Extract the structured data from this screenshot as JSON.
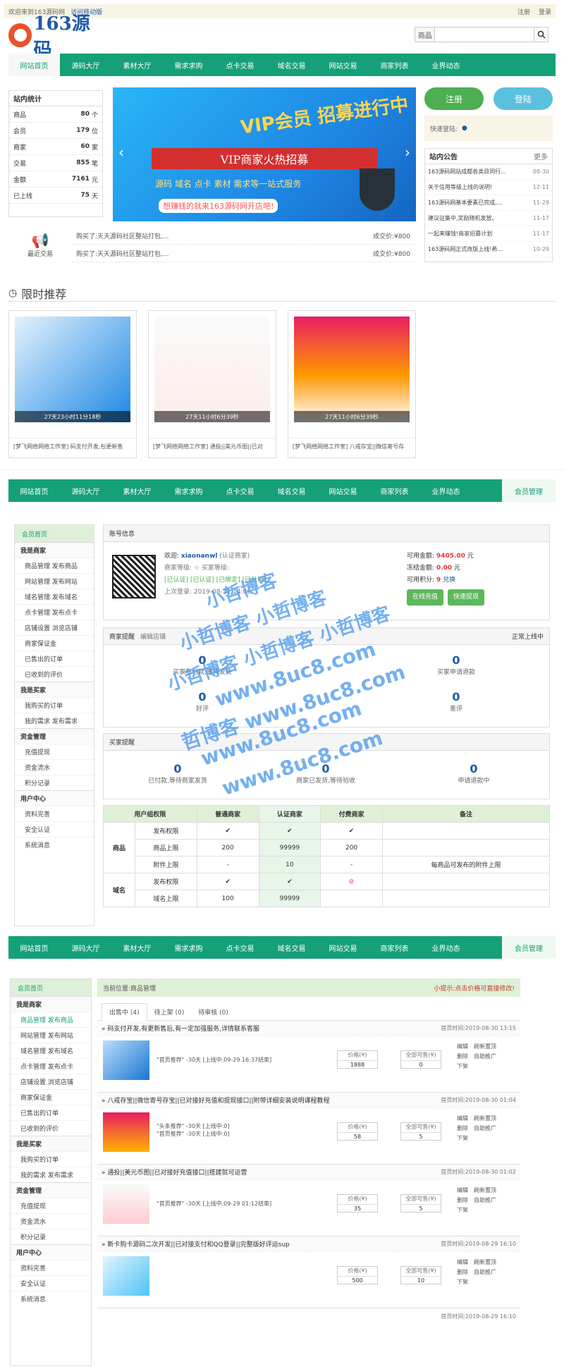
{
  "topbar": {
    "welcome": "欢迎来到163源码网",
    "mobile": "访问移动版",
    "register": "注册",
    "login": "登录"
  },
  "logo": {
    "text": "163源码"
  },
  "search": {
    "label": "商品",
    "placeholder": ""
  },
  "nav": {
    "items": [
      "网站首页",
      "源码大厅",
      "素材大厅",
      "需求求购",
      "点卡交易",
      "域名交易",
      "网站交易",
      "商家列表",
      "业界动态"
    ],
    "member": "会员管理"
  },
  "stats": {
    "title": "站内统计",
    "rows": [
      {
        "label": "商品",
        "value": "80",
        "unit": "个"
      },
      {
        "label": "会员",
        "value": "179",
        "unit": "位"
      },
      {
        "label": "商家",
        "value": "60",
        "unit": "家"
      },
      {
        "label": "交易",
        "value": "855",
        "unit": "笔"
      },
      {
        "label": "金额",
        "value": "7161",
        "unit": "元"
      },
      {
        "label": "已上线",
        "value": "75",
        "unit": "天"
      }
    ]
  },
  "banner": {
    "vip": "VIP会员 招募进行中",
    "ribbon": "VIP商家火热招募",
    "sub": "源码 域名 点卡 素材 需求等一站式服务",
    "sub2": "想赚钱的就来163源码网开店吧!"
  },
  "buttons": {
    "register": "注册",
    "login": "登陆"
  },
  "quick_login": "快速登陆:",
  "notice": {
    "title": "站内公告",
    "more": "更多",
    "rows": [
      {
        "text": "163源码网站成都各类目同行...",
        "date": "08-30"
      },
      {
        "text": "关于信用等级上线的说明!",
        "date": "12-11"
      },
      {
        "text": "163源码网基本要素已完成,...",
        "date": "11-29"
      },
      {
        "text": "建议征集中,奖励随机发放。",
        "date": "11-17"
      },
      {
        "text": "一起来赚钱!商家招募计划",
        "date": "11-17"
      },
      {
        "text": "163源码网正式改版上线!希...",
        "date": "10-29"
      }
    ]
  },
  "recent": {
    "label": "最近交易",
    "rows": [
      {
        "text": "购买了:天天源码社区整站打包,...",
        "price": "成交价:¥800"
      },
      {
        "text": "购买了:天天源码社区整站打包,...",
        "price": "成交价:¥800"
      }
    ]
  },
  "limited": {
    "title": "限时推荐",
    "cards": [
      {
        "timer": "27天23小时11分18秒",
        "caption": "[梦飞网络网络工作室] 码支付开发,包更新售"
      },
      {
        "timer": "27天11小时6分39秒",
        "caption": "[梦飞网络网络工作室] 通投||美元币图||已对"
      },
      {
        "timer": "27天11小时6分39秒",
        "caption": "[梦飞网络网络工作室] 八戒存宝||微信寄号存"
      }
    ]
  },
  "member_side": {
    "home": "会员首页",
    "groups": [
      {
        "title": "我是商家",
        "items": [
          "商品管理 发布商品",
          "网站管理 发布网站",
          "域名管理 发布域名",
          "点卡管理 发布点卡",
          "店铺设置 浏览店铺",
          "商家保证金",
          "已售出的订单",
          "已收到的评价"
        ]
      },
      {
        "title": "我是买家",
        "items": [
          "我购买的订单",
          "我的需求 发布需求"
        ]
      },
      {
        "title": "资金管理",
        "items": [
          "充值提现",
          "资金流水",
          "积分记录"
        ]
      },
      {
        "title": "用户中心",
        "items": [
          "资料完善",
          "安全认证",
          "系统消息"
        ]
      }
    ]
  },
  "account": {
    "title": "账号信息",
    "welcome": "欢迎:",
    "username": "xiaonanwl",
    "auth": "(认证商家)",
    "level": "商家等级:",
    "level2": "买家等级:",
    "badges": "[已认证]  [已认证]  [已绑定]  [已认证]",
    "last_login": "上次登录:",
    "last_time": "2019-08-31 14:06",
    "balance_label": "可用金额:",
    "balance": "9405.00",
    "balance_unit": "元",
    "frozen_label": "冻结金额:",
    "frozen": "0.00",
    "frozen_unit": "元",
    "points_label": "可用积分:",
    "points": "9",
    "exchange": "兑换",
    "recharge": "在线充值",
    "withdraw": "快速提现"
  },
  "seller": {
    "title": "商家提醒",
    "edit": "编辑店铺",
    "status": "正常上线中",
    "a": {
      "n": "0",
      "l": "买家已付款,等待发货"
    },
    "b": {
      "n": "0",
      "l": "买家申请退款"
    },
    "c": {
      "n": "0",
      "l": "好评"
    },
    "d": {
      "n": "0",
      "l": "差评"
    }
  },
  "buyer": {
    "title": "买家提醒",
    "a": {
      "n": "0",
      "l": "已付款,等待商家发货"
    },
    "b": {
      "n": "0",
      "l": "商家已发货,等待验收"
    },
    "c": {
      "n": "0",
      "l": "申请退款中"
    }
  },
  "perm": {
    "headers": [
      "用户组权限",
      "",
      "普通商家",
      "认证商家",
      "付费商家",
      "备注"
    ],
    "goods": "商品",
    "domain": "域名",
    "rows": [
      [
        "发布权限",
        "✔",
        "✔",
        "✔",
        ""
      ],
      [
        "商品上限",
        "200",
        "99999",
        "200",
        ""
      ],
      [
        "附件上限",
        "-",
        "10",
        "-",
        "每商品可发布的附件上限"
      ],
      [
        "发布权限",
        "✔",
        "✔",
        "⊘",
        ""
      ],
      [
        "域名上限",
        "100",
        "99999",
        "",
        ""
      ]
    ]
  },
  "watermark": [
    "小哲博客",
    "小哲博客 小哲博客",
    "小哲博客 小哲博客 小哲博客",
    "www.8uc8.com",
    "哲博客 www.8uc8.com",
    "www.8uc8.com",
    "www.8uc8.com"
  ],
  "manage": {
    "crumb": "当前位置:商品管理",
    "tip": "小提示:点击价格可直接修改!",
    "tabs": [
      "出售中 (4)",
      "待上架 (0)",
      "待审核 (0)"
    ],
    "price_label": "价格(¥)",
    "stock_label": "全部可售(¥)",
    "ops": [
      "编辑",
      "刷新置顶",
      "删除",
      "自助推广",
      "下架"
    ],
    "products": [
      {
        "title": "» 码支付开发,有更新售后,有一定加强服务,详情联系客服",
        "time": "首页时间:2019-08-30 13:15",
        "desc": "\"首页推荐\" -30天 [上线中,09-29 16:37结束]",
        "price": "1888",
        "stock": "0"
      },
      {
        "title": "» 八戒存宝||微信寄号存宝||已对接好充值和提现接口||附带详细安装说明课程教程",
        "time": "首页时间:2019-08-30 01:04",
        "desc": "\"头条推荐\" -30天 [上线中:0]\n\"首页推荐\" -30天 [上线中:0]",
        "price": "58",
        "stock": "5"
      },
      {
        "title": "» 通投||美元币图||已对接好充值接口||搭建就可运营",
        "time": "首页时间:2019-08-30 01:02",
        "desc": "\"首页推荐\" -30天 [上线中,09-29 01:12结束]",
        "price": "35",
        "stock": "5"
      },
      {
        "title": "» 新卡购卡源码二次开发||已对接支付和QQ登录||完整版好评运sup",
        "time": "首页时间:2019-08-29 16:10",
        "desc": "",
        "price": "500",
        "stock": "10"
      }
    ],
    "footer_time": "首页时间:2019-08-29 16:10"
  }
}
